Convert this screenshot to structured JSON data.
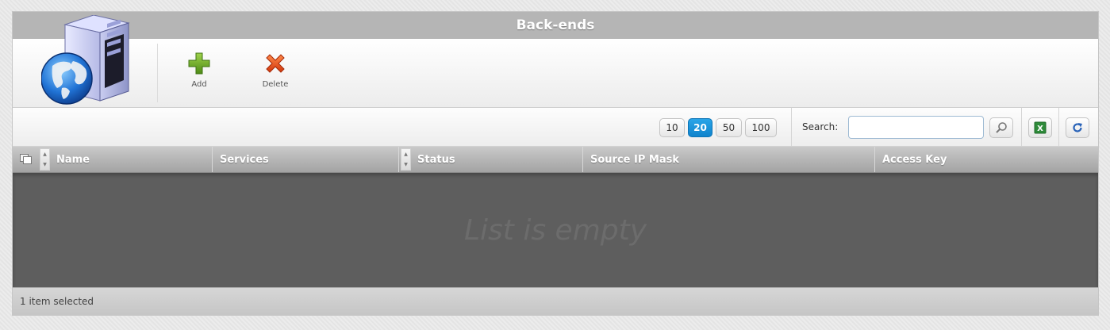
{
  "window": {
    "title": "Back-ends"
  },
  "toolbar": {
    "add_label": "Add",
    "delete_label": "Delete"
  },
  "pager": {
    "options": [
      "10",
      "20",
      "50",
      "100"
    ],
    "selected": "20"
  },
  "search": {
    "label": "Search:",
    "value": "",
    "placeholder": ""
  },
  "grid": {
    "columns": [
      "Name",
      "Services",
      "Status",
      "Source IP Mask",
      "Access Key"
    ],
    "empty_text": "List is empty"
  },
  "status": {
    "text": "1 item selected"
  },
  "colors": {
    "accent": "#1a92d8",
    "header": "#b5b5b5",
    "body": "#5e5e5e"
  }
}
